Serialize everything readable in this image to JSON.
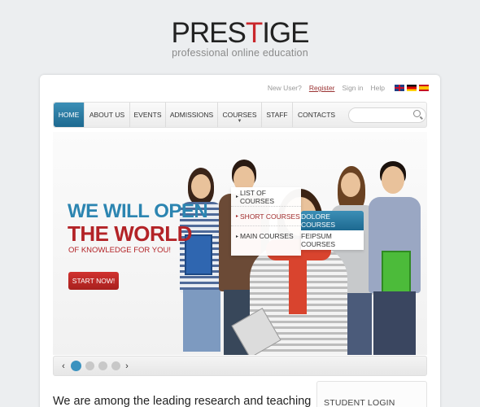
{
  "logo": {
    "prefix": "PRES",
    "highlight": "T",
    "suffix": "IGE",
    "tagline": "professional online education"
  },
  "util": {
    "new_user": "New User?",
    "register": "Register",
    "sign_in": "Sign in",
    "help": "Help"
  },
  "nav": {
    "items": [
      "HOME",
      "ABOUT US",
      "EVENTS",
      "ADMISSIONS",
      "COURSES",
      "STAFF",
      "CONTACTS"
    ],
    "active": "HOME",
    "search_placeholder": ""
  },
  "dropdown": {
    "items": [
      "LIST OF COURSES",
      "SHORT COURSES",
      "MAIN COURSES"
    ],
    "highlighted": "SHORT COURSES",
    "sub_items": [
      "DOLORE COURSES",
      "FEIPSUM COURSES"
    ]
  },
  "hero": {
    "line1": "WE WILL OPEN",
    "line2": "THE WORLD",
    "line3": "OF KNOWLEDGE FOR YOU!",
    "button": "START NOW!"
  },
  "slider": {
    "total_slides": 4,
    "current_slide": 1
  },
  "bottom": {
    "headline": "We are among the leading research and teaching",
    "login_title": "STUDENT LOGIN"
  },
  "colors": {
    "accent_blue": "#2c85b1",
    "accent_red": "#b32327"
  }
}
